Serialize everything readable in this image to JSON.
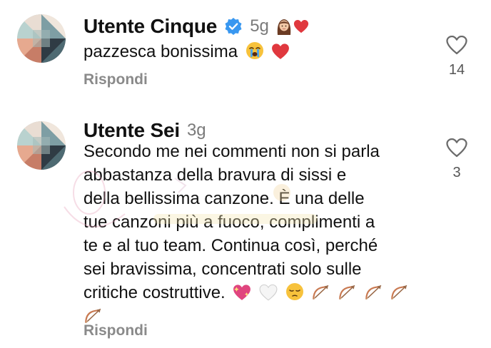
{
  "comments": [
    {
      "username": "Utente Cinque",
      "verified": true,
      "time": "5g",
      "header_emojis": [
        "woman-emoji",
        "red-heart-emoji"
      ],
      "text_lines": [
        "pazzesca bonissima"
      ],
      "trailing_emojis": [
        "crying-face-emoji",
        "red-heart-emoji"
      ],
      "reply_label": "Rispondi",
      "like_count": "14"
    },
    {
      "username": "Utente Sei",
      "verified": false,
      "time": "3g",
      "text_lines": [
        "Secondo me nei commenti non si parla",
        "abbastanza della bravura di sissi e",
        "della bellissima canzone. È una delle",
        "tue canzoni più a fuoco, complimenti a",
        "te e al tuo team. Continua così, perché",
        "sei bravissima, concentrati solo sulle",
        "critiche costruttive."
      ],
      "trailing_emojis": [
        "sparkling-heart-emoji",
        "white-heart-emoji",
        "pensive-face-emoji",
        "bow-and-arrow-emoji",
        "bow-and-arrow-emoji",
        "bow-and-arrow-emoji",
        "bow-and-arrow-emoji",
        "bow-and-arrow-emoji"
      ],
      "reply_label": "Rispondi",
      "like_count": "3"
    }
  ],
  "colors": {
    "verified_blue": "#3897f0",
    "secondary_text": "#8a8a8a",
    "heart_red": "#e0383e"
  }
}
